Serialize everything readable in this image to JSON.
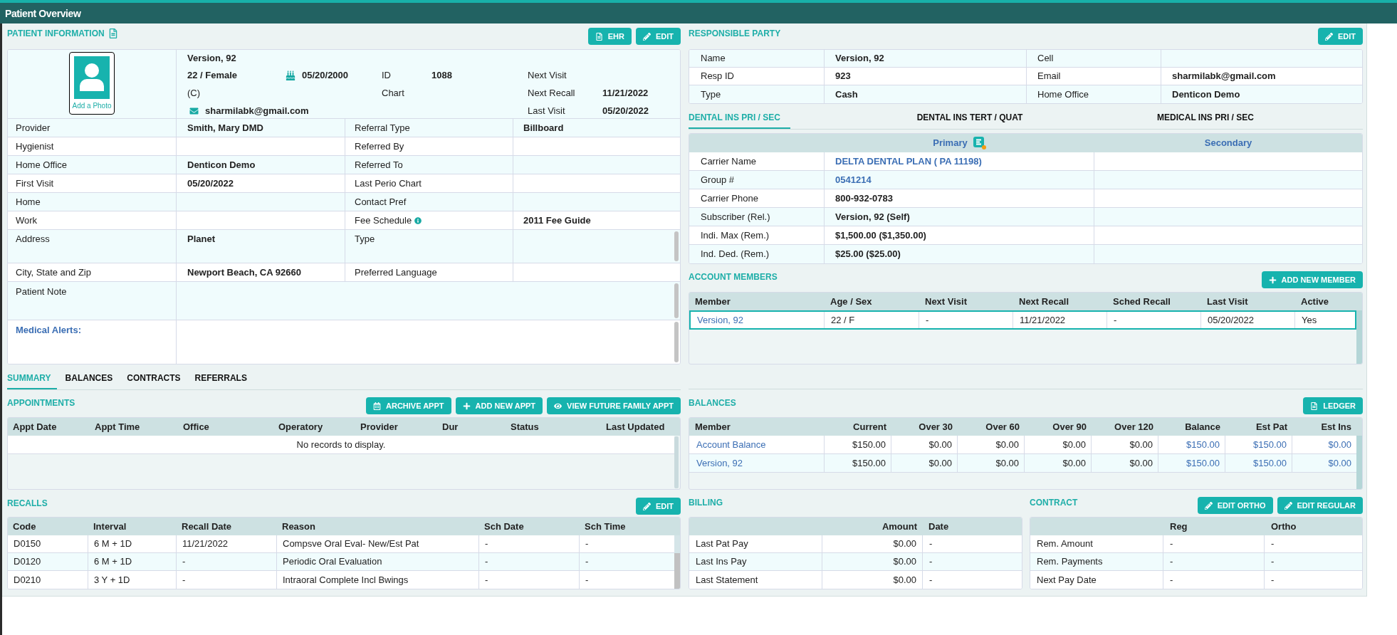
{
  "window": {
    "title": "Patient Overview"
  },
  "patient_information": {
    "title": "PATIENT INFORMATION",
    "buttons": [
      {
        "kind": "ehr",
        "label": "EHR"
      },
      {
        "kind": "edit",
        "label": "EDIT"
      }
    ],
    "photo_caption": "Add a Photo",
    "name": "Version, 92",
    "age_sex": "22 / Female",
    "birth_date": "05/20/2000",
    "phone": "(C)",
    "email": "sharmilabk@gmail.com",
    "ids": [
      {
        "label": "ID",
        "value": "1088"
      },
      {
        "label": "Chart"
      }
    ],
    "visits": [
      {
        "label": "Next Visit"
      },
      {
        "label": "Next Recall",
        "value": "11/21/2022"
      },
      {
        "label": "Last Visit",
        "value": "05/20/2022"
      }
    ],
    "details": [
      {
        "kind": "field",
        "label": "Provider",
        "value": "Smith, Mary DMD",
        "label_2": "Referral Type",
        "value_2": "Billboard"
      },
      {
        "kind": "field",
        "label": "Hygienist",
        "label_2": "Referred By"
      },
      {
        "kind": "field",
        "label": "Home Office",
        "value": "Denticon Demo",
        "label_2": "Referred To"
      },
      {
        "kind": "field",
        "label": "First Visit",
        "value": "05/20/2022",
        "label_2": "Last Perio Chart"
      },
      {
        "kind": "field",
        "label": "Home",
        "label_2": "Contact Pref"
      },
      {
        "kind": "field",
        "label": "Work",
        "label_2": "Fee Schedule",
        "info": true,
        "value_2": "2011 Fee Guide"
      },
      {
        "kind": "multiline",
        "label": "Address",
        "value": "Planet",
        "label_2": "Type"
      },
      {
        "kind": "field",
        "label": "City, State and Zip",
        "value": "Newport Beach, CA 92660",
        "label_2": "Preferred Language"
      },
      {
        "kind": "note",
        "label": "Patient Note"
      },
      {
        "kind": "alerts",
        "label": "Medical Alerts:"
      }
    ]
  },
  "responsible_party": {
    "title": "RESPONSIBLE PARTY",
    "buttons": [
      {
        "kind": "edit",
        "label": "EDIT"
      }
    ],
    "rows": [
      {
        "label": "Name",
        "value": "Version, 92",
        "label_2": "Cell"
      },
      {
        "label": "Resp ID",
        "value": "923",
        "label_2": "Email",
        "value_2": "sharmilabk@gmail.com"
      },
      {
        "label": "Type",
        "value": "Cash",
        "label_2": "Home Office",
        "value_2": "Denticon Demo"
      }
    ]
  },
  "insurance_tabs": [
    {
      "label": "DENTAL INS PRI / SEC",
      "selected": true
    },
    {
      "label": "DENTAL INS TERT / QUAT",
      "selected": false
    },
    {
      "label": "MEDICAL INS PRI / SEC",
      "selected": false
    }
  ],
  "insurance": {
    "columns": [
      "Primary",
      "Secondary"
    ],
    "rows": [
      {
        "kind": "link",
        "label": "Carrier Name",
        "primary": "DELTA DENTAL PLAN ( PA 11198)"
      },
      {
        "kind": "link",
        "label": "Group #",
        "primary": "0541214"
      },
      {
        "kind": "text",
        "label": "Carrier Phone",
        "primary": "800-932-0783"
      },
      {
        "kind": "text",
        "label": "Subscriber (Rel.)",
        "primary": "Version, 92 (Self)"
      },
      {
        "kind": "text",
        "label": "Indi. Max (Rem.)",
        "primary": "$1,500.00 ($1,350.00)"
      },
      {
        "kind": "text",
        "label": "Ind. Ded. (Rem.)",
        "primary": "$25.00 ($25.00)"
      }
    ]
  },
  "account_members": {
    "title": "ACCOUNT MEMBERS",
    "buttons": [
      {
        "kind": "add",
        "label": "ADD NEW MEMBER"
      }
    ],
    "columns": [
      "Member",
      "Age / Sex",
      "Next Visit",
      "Next Recall",
      "Sched Recall",
      "Last Visit",
      "Active"
    ],
    "rows": [
      {
        "cells": [
          "Version, 92",
          "22 / F",
          "-",
          "11/21/2022",
          "-",
          "05/20/2022",
          "Yes"
        ],
        "selected": true
      }
    ]
  },
  "summary_tabs": [
    {
      "label": "SUMMARY",
      "selected": true
    },
    {
      "label": "BALANCES",
      "selected": false
    },
    {
      "label": "CONTRACTS",
      "selected": false
    },
    {
      "label": "REFERRALS",
      "selected": false
    }
  ],
  "appointments": {
    "title": "APPOINTMENTS",
    "buttons": [
      {
        "kind": "archive",
        "label": "ARCHIVE APPT"
      },
      {
        "kind": "add",
        "label": "ADD NEW APPT"
      },
      {
        "kind": "view",
        "label": "VIEW FUTURE FAMILY APPT"
      }
    ],
    "columns": [
      "Appt Date",
      "Appt Time",
      "Office",
      "Operatory",
      "Provider",
      "Dur",
      "Status",
      "Last Updated"
    ],
    "empty_message": "No records to display."
  },
  "balances": {
    "title": "BALANCES",
    "buttons": [
      {
        "kind": "ledger",
        "label": "LEDGER"
      }
    ],
    "columns": [
      "Member",
      "Current",
      "Over 30",
      "Over 60",
      "Over 90",
      "Over 120",
      "Balance",
      "Est Pat",
      "Est Ins"
    ],
    "rows": [
      [
        "Account Balance",
        "$150.00",
        "$0.00",
        "$0.00",
        "$0.00",
        "$0.00",
        "$150.00",
        "$150.00",
        "$0.00"
      ],
      [
        "Version, 92",
        "$150.00",
        "$0.00",
        "$0.00",
        "$0.00",
        "$0.00",
        "$150.00",
        "$150.00",
        "$0.00"
      ]
    ]
  },
  "recalls": {
    "title": "RECALLS",
    "buttons": [
      {
        "kind": "edit",
        "label": "EDIT"
      }
    ],
    "columns": [
      "Code",
      "Interval",
      "Recall Date",
      "Reason",
      "Sch Date",
      "Sch Time"
    ],
    "rows": [
      [
        "D0150",
        "6 M + 1D",
        "11/21/2022",
        "Compsve Oral Eval- New/Est Pat",
        "-",
        "-"
      ],
      [
        "D0120",
        "6 M + 1D",
        "-",
        "Periodic Oral Evaluation",
        "-",
        "-"
      ],
      [
        "D0210",
        "3 Y + 1D",
        "-",
        "Intraoral Complete Incl Bwings",
        "-",
        "-"
      ]
    ]
  },
  "billing": {
    "title": "BILLING",
    "columns": [
      "Amount",
      "Date"
    ],
    "rows": [
      {
        "label": "Last Pat Pay",
        "amount": "$0.00",
        "date": "-"
      },
      {
        "label": "Last Ins Pay",
        "amount": "$0.00",
        "date": "-"
      },
      {
        "label": "Last Statement",
        "amount": "$0.00",
        "date": "-"
      }
    ]
  },
  "contract": {
    "title": "CONTRACT",
    "buttons": [
      {
        "kind": "edit",
        "label": "EDIT ORTHO"
      },
      {
        "kind": "edit",
        "label": "EDIT REGULAR"
      }
    ],
    "columns": [
      "Reg",
      "Ortho"
    ],
    "rows": [
      {
        "label": "Rem. Amount",
        "reg": "-",
        "ortho": "-"
      },
      {
        "label": "Rem. Payments",
        "reg": "-",
        "ortho": "-"
      },
      {
        "label": "Next Pay Date",
        "reg": "-",
        "ortho": "-"
      }
    ]
  }
}
